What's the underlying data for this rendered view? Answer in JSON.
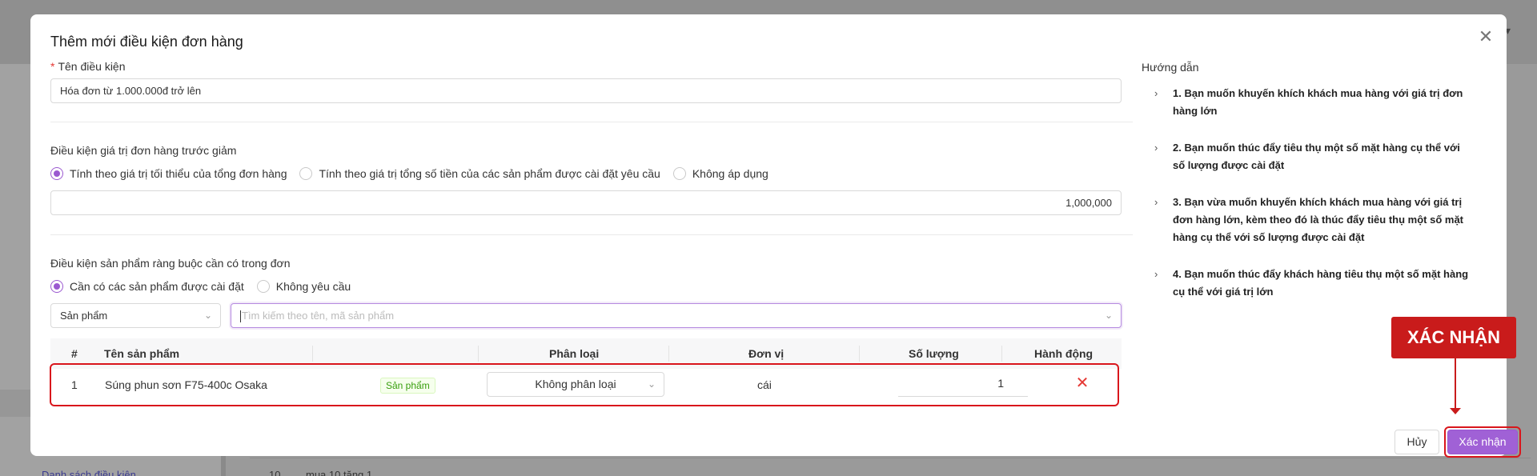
{
  "background": {
    "sidebar_link": "Danh sách điều kiện",
    "row_number": "10",
    "row_text": "mua 10 tặng 1"
  },
  "modal": {
    "title": "Thêm mới điều kiện đơn hàng",
    "close_icon": "close-icon"
  },
  "condition_name": {
    "required_mark": "*",
    "label": "Tên điều kiện",
    "value": "Hóa đơn từ 1.000.000đ trở lên"
  },
  "order_value": {
    "label": "Điều kiện giá trị đơn hàng trước giảm",
    "options": [
      {
        "label": "Tính theo giá trị tối thiểu của tổng đơn hàng",
        "checked": true
      },
      {
        "label": "Tính theo giá trị tổng số tiền của các sản phẩm được cài đặt yêu cầu",
        "checked": false
      },
      {
        "label": "Không áp dụng",
        "checked": false
      }
    ],
    "amount": "1,000,000"
  },
  "product_condition": {
    "label": "Điều kiện sản phẩm ràng buộc cần có trong đơn",
    "options": [
      {
        "label": "Cần có các sản phẩm được cài đặt",
        "checked": true
      },
      {
        "label": "Không yêu cầu",
        "checked": false
      }
    ],
    "type_select": "Sản phẩm",
    "search_placeholder": "Tìm kiếm theo tên, mã sản phẩm"
  },
  "table": {
    "headers": {
      "index": "#",
      "name": "Tên sản phẩm",
      "category": "Phân loại",
      "unit": "Đơn vị",
      "quantity": "Số lượng",
      "action": "Hành động"
    },
    "rows": [
      {
        "index": "1",
        "name": "Súng phun sơn F75-400c Osaka",
        "tag": "Sản phẩm",
        "category": "Không phân loại",
        "unit": "cái",
        "quantity": "1"
      }
    ]
  },
  "guide": {
    "title": "Hướng dẫn",
    "items": [
      "1. Bạn muốn khuyến khích khách mua hàng với giá trị đơn hàng lớn",
      "2. Bạn muốn thúc đẩy tiêu thụ một số mặt hàng cụ thể với số lượng được cài đặt",
      "3. Bạn vừa muốn khuyến khích khách mua hàng với giá trị đơn hàng lớn, kèm theo đó là thúc đẩy tiêu thụ một số mặt hàng cụ thể với số lượng được cài đặt",
      "4. Bạn muốn thúc đẩy khách hàng tiêu thụ một số mặt hàng cụ thể với giá trị lớn"
    ]
  },
  "annotation": {
    "label": "XÁC NHẬN"
  },
  "footer": {
    "cancel": "Hủy",
    "confirm": "Xác nhận"
  },
  "colors": {
    "accent": "#9b59d0",
    "highlight": "#d9161c"
  }
}
